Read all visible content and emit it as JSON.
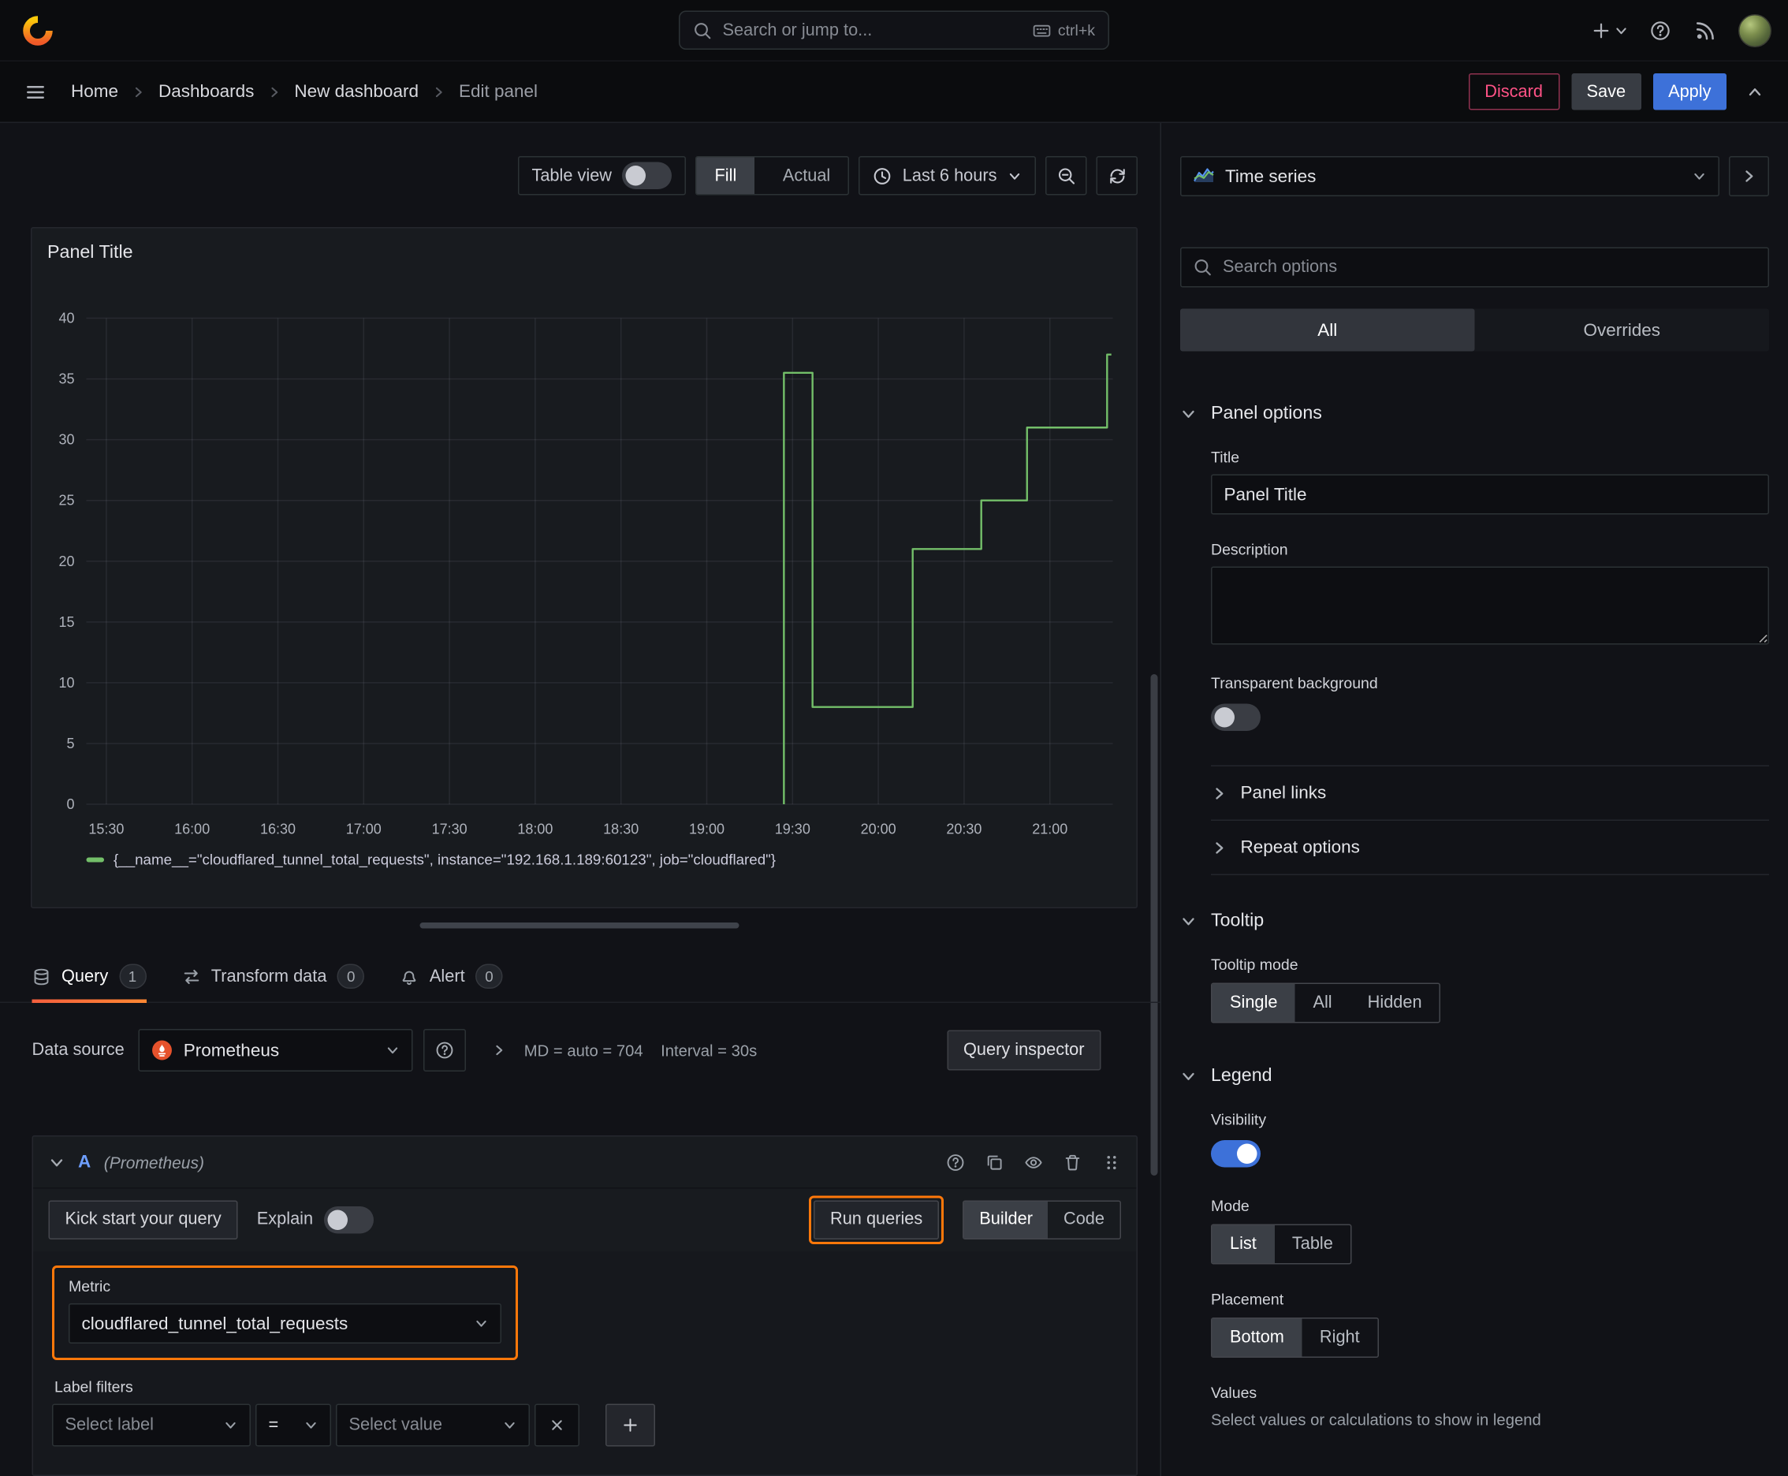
{
  "colors": {
    "accent_blue": "#3d71d9",
    "annotation_orange": "#ff780a",
    "series_green": "#73bf69",
    "destructive_pink": "#ff5286"
  },
  "topbar": {
    "search_placeholder": "Search or jump to...",
    "search_shortcut": "ctrl+k"
  },
  "breadcrumb": {
    "items": [
      "Home",
      "Dashboards",
      "New dashboard",
      "Edit panel"
    ]
  },
  "actions": {
    "discard": "Discard",
    "save": "Save",
    "apply": "Apply"
  },
  "toolbar": {
    "table_view_label": "Table view",
    "fill_label": "Fill",
    "actual_label": "Actual",
    "time_range_label": "Last 6 hours"
  },
  "panel": {
    "title": "Panel Title",
    "legend": "{__name__=\"cloudflared_tunnel_total_requests\", instance=\"192.168.1.189:60123\", job=\"cloudflared\"}"
  },
  "chart_data": {
    "type": "line",
    "title": "Panel Title",
    "x_ticks": [
      "15:30",
      "16:00",
      "16:30",
      "17:00",
      "17:30",
      "18:00",
      "18:30",
      "19:00",
      "19:30",
      "20:00",
      "20:30",
      "21:00"
    ],
    "x_tick_minutes": [
      0,
      30,
      60,
      90,
      120,
      150,
      180,
      210,
      240,
      270,
      300,
      330
    ],
    "x_domain_minutes": [
      -7,
      352
    ],
    "y_ticks": [
      0,
      5,
      10,
      15,
      20,
      25,
      30,
      35,
      40
    ],
    "ylim": [
      0,
      40
    ],
    "grid": true,
    "legend_position": "bottom",
    "series": [
      {
        "name": "{__name__=\"cloudflared_tunnel_total_requests\", instance=\"192.168.1.189:60123\", job=\"cloudflared\"}",
        "color": "#73bf69",
        "points": [
          [
            237,
            0
          ],
          [
            237,
            35.5
          ],
          [
            247,
            35.5
          ],
          [
            247,
            8
          ],
          [
            282,
            8
          ],
          [
            282,
            21
          ],
          [
            306,
            21
          ],
          [
            306,
            25
          ],
          [
            322,
            25
          ],
          [
            322,
            31
          ],
          [
            350,
            31
          ],
          [
            350,
            37
          ],
          [
            351.5,
            37
          ]
        ]
      }
    ]
  },
  "tabs": {
    "query": {
      "label": "Query",
      "badge": "1"
    },
    "transform": {
      "label": "Transform data",
      "badge": "0"
    },
    "alert": {
      "label": "Alert",
      "badge": "0"
    }
  },
  "query": {
    "datasource_label": "Data source",
    "datasource_name": "Prometheus",
    "stats_md": "MD = auto = 704",
    "stats_interval": "Interval = 30s",
    "inspector_label": "Query inspector",
    "ref_id": "A",
    "ref_note": "(Prometheus)",
    "kickstart_label": "Kick start your query",
    "explain_label": "Explain",
    "run_label": "Run queries",
    "builder_label": "Builder",
    "code_label": "Code",
    "metric_label": "Metric",
    "metric_value": "cloudflared_tunnel_total_requests",
    "label_filters_label": "Label filters",
    "select_label_placeholder": "Select label",
    "operator_value": "=",
    "select_value_placeholder": "Select value"
  },
  "options": {
    "viz_name": "Time series",
    "search_placeholder": "Search options",
    "tabs": {
      "all": "All",
      "overrides": "Overrides"
    },
    "panel": {
      "header": "Panel options",
      "title_label": "Title",
      "title_value": "Panel Title",
      "description_label": "Description",
      "transparent_label": "Transparent background",
      "links_label": "Panel links",
      "repeat_label": "Repeat options"
    },
    "tooltip": {
      "header": "Tooltip",
      "mode_label": "Tooltip mode",
      "modes": [
        "Single",
        "All",
        "Hidden"
      ]
    },
    "legend": {
      "header": "Legend",
      "visibility_label": "Visibility",
      "mode_label": "Mode",
      "modes": [
        "List",
        "Table"
      ],
      "placement_label": "Placement",
      "placements": [
        "Bottom",
        "Right"
      ],
      "values_label": "Values",
      "values_hint": "Select values or calculations to show in legend"
    }
  }
}
